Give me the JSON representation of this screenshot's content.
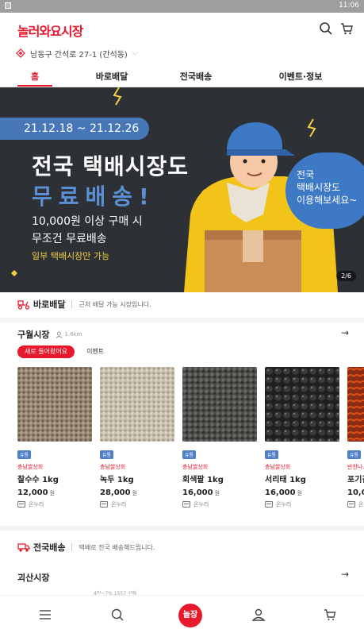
{
  "status_bar": {
    "time": "11:06"
  },
  "header": {
    "logo": "놀러와요시장",
    "search_icon": "search-icon",
    "cart_icon": "cart-icon"
  },
  "location": {
    "address": "남동구 간석로 27-1 (간석동)",
    "icon": "location-pin-icon"
  },
  "tabs": [
    {
      "label": "홈",
      "active": true
    },
    {
      "label": "바로배달",
      "active": false
    },
    {
      "label": "전국배송",
      "active": false
    },
    {
      "label": "이벤트·정보",
      "active": false
    }
  ],
  "banner": {
    "date_range": "21.12.18 ~ 21.12.26",
    "headline1": "전국 택배시장도",
    "headline2": "무료배송!",
    "line1": "10,000원 이상 구매 시",
    "line2": "무조건 무료배송",
    "note": "일부 택배시장만 가능",
    "bubble": [
      "전국",
      "택배시장도",
      "이용해보세요~"
    ],
    "page_indicator": "2/6",
    "colors": {
      "background": "#2d3136",
      "accent_blue": "#4877b7",
      "highlight_yellow": "#f4d03f"
    }
  },
  "quick_delivery": {
    "title": "바로배달",
    "description": "근처 배달 가능 시장입니다."
  },
  "market1": {
    "name": "구월시장",
    "distance": "1.6km",
    "filters": [
      {
        "label": "새로 들어왔어요",
        "active": true
      },
      {
        "label": "이벤트",
        "active": false
      }
    ],
    "products": [
      {
        "badge": "유통",
        "seller": "충남쌀상회",
        "name": "찰수수 1kg",
        "price": "12,000",
        "won": "원",
        "payment": "온누리"
      },
      {
        "badge": "유통",
        "seller": "충남쌀상회",
        "name": "녹두 1kg",
        "price": "28,000",
        "won": "원",
        "payment": "온누리"
      },
      {
        "badge": "유통",
        "seller": "충남쌀상회",
        "name": "회색팥 1kg",
        "price": "16,000",
        "won": "원",
        "payment": "온누리"
      },
      {
        "badge": "유통",
        "seller": "충남쌀상회",
        "name": "서리태 1kg",
        "price": "16,000",
        "won": "원",
        "payment": "온누리"
      },
      {
        "badge": "유통",
        "seller": "반찬나...",
        "name": "포기김...",
        "price": "10,0",
        "won": "",
        "payment": "온"
      }
    ]
  },
  "nationwide": {
    "title": "전국배송",
    "description": "택배로 전국 배송해드립니다."
  },
  "market2": {
    "name": "괴산시장",
    "peek_text": "4만~7% 1557 구매"
  },
  "bottom_nav": {
    "items": [
      "menu-icon",
      "search-icon",
      "home-logo",
      "user-icon",
      "cart-icon"
    ],
    "center_label": "놀장"
  },
  "brand_color": "#e8192c"
}
